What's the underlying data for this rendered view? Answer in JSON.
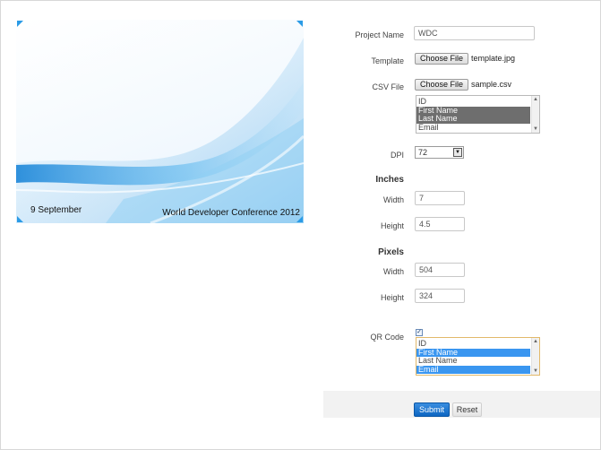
{
  "preview": {
    "date": "9 September",
    "title": "World Developer Conference 2012"
  },
  "form": {
    "project_name": {
      "label": "Project Name",
      "value": "WDC"
    },
    "template": {
      "label": "Template",
      "button": "Choose File",
      "file": "template.jpg"
    },
    "csv_file": {
      "label": "CSV File",
      "button": "Choose File",
      "file": "sample.csv",
      "fields": [
        {
          "label": "ID",
          "selected": false
        },
        {
          "label": "First Name",
          "selected": true
        },
        {
          "label": "Last Name",
          "selected": true
        },
        {
          "label": "Email",
          "selected": false
        }
      ]
    },
    "dpi": {
      "label": "DPI",
      "value": "72"
    },
    "inches": {
      "heading": "Inches",
      "width": {
        "label": "Width",
        "value": "7"
      },
      "height": {
        "label": "Height",
        "value": "4.5"
      }
    },
    "pixels": {
      "heading": "Pixels",
      "width": {
        "label": "Width",
        "value": "504"
      },
      "height": {
        "label": "Height",
        "value": "324"
      }
    },
    "qr_code": {
      "label": "QR Code",
      "checked": true,
      "fields": [
        {
          "label": "ID",
          "selected": false
        },
        {
          "label": "First Name",
          "selected": true
        },
        {
          "label": "Last Name",
          "selected": false
        },
        {
          "label": "Email",
          "selected": true
        }
      ]
    }
  },
  "actions": {
    "submit": "Submit",
    "reset": "Reset"
  },
  "colors": {
    "accent": "#0d66c2",
    "wave": "#3aa3e6",
    "qr_selection": "#3a96f0",
    "csv_selection": "#6e6e6e"
  }
}
